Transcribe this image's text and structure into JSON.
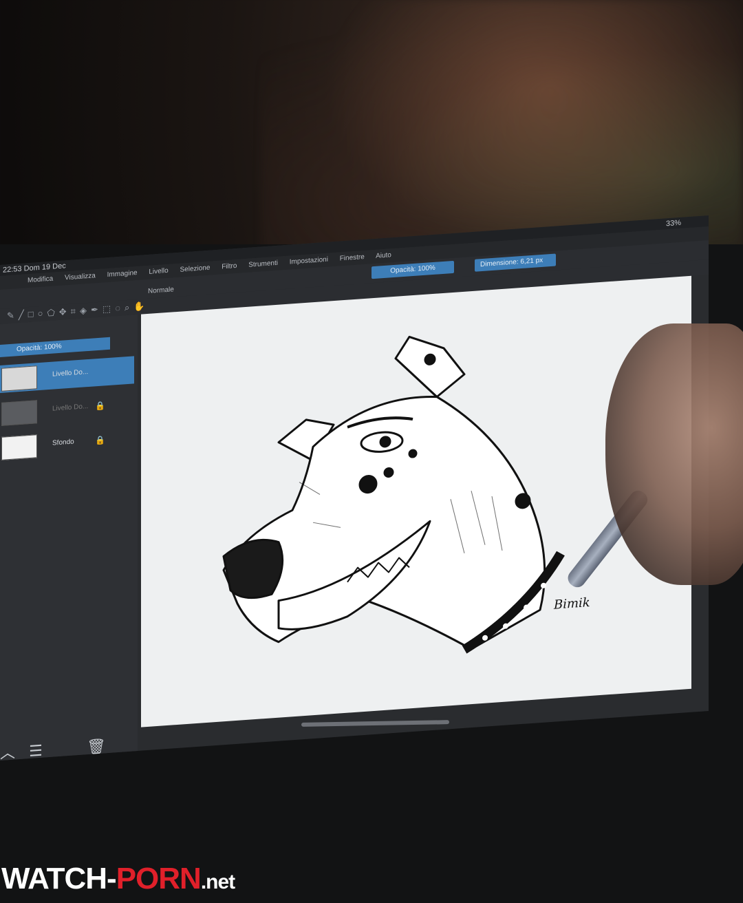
{
  "status_bar": {
    "time": "22:53",
    "date": "Dom 19 Dec",
    "battery": "33%"
  },
  "menu": {
    "items": [
      "Modifica",
      "Visualizza",
      "Immagine",
      "Livello",
      "Selezione",
      "Filtro",
      "Strumenti",
      "Impostazioni",
      "Finestre",
      "Aiuto"
    ]
  },
  "toolbar": {
    "blend_mode": "Normale",
    "opacity": "Opacità: 100%",
    "size": "Dimensione: 6,21 px"
  },
  "layers": {
    "panel_opacity": "Opacità: 100%",
    "items": [
      {
        "name": "Livello Do...",
        "active": true
      },
      {
        "name": "Livello Do...",
        "active": false
      },
      {
        "name": "Sfondo",
        "active": false
      }
    ]
  },
  "drawing": {
    "signature": "Bimik"
  },
  "icons": {
    "layer_lock": "lock-icon",
    "layer_alpha": "alpha-icon",
    "layer_visible": "eye-icon",
    "collapse": "chevron-up-icon",
    "properties": "sliders-icon",
    "delete": "trash-icon"
  },
  "watermark": {
    "part1": "WATCH-",
    "part2": "PORN",
    "part3": ".net"
  },
  "colors": {
    "accent": "#3d7eb8",
    "panel": "#2e3034",
    "canvas": "#eef0f1"
  }
}
